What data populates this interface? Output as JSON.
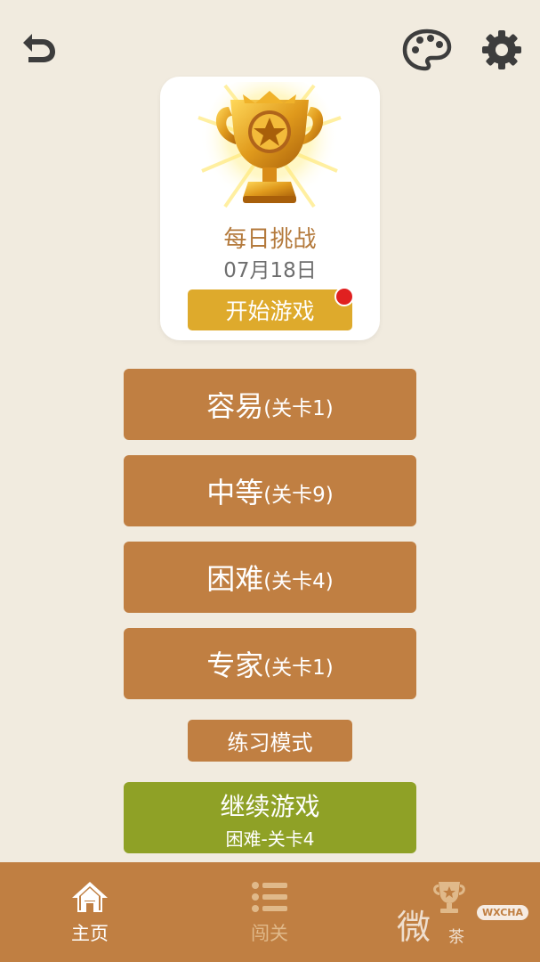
{
  "header": {
    "back_icon": "back-arrow-icon",
    "palette_icon": "palette-icon",
    "settings_icon": "gear-icon"
  },
  "daily_challenge": {
    "icon": "trophy-icon",
    "title": "每日挑战",
    "date": "07月18日",
    "start_label": "开始游戏",
    "notification_dot": true
  },
  "levels": [
    {
      "name": "容易",
      "stage": "(关卡1)"
    },
    {
      "name": "中等",
      "stage": "(关卡9)"
    },
    {
      "name": "困难",
      "stage": "(关卡4)"
    },
    {
      "name": "专家",
      "stage": "(关卡1)"
    }
  ],
  "practice": {
    "label": "练习模式"
  },
  "continue_game": {
    "title": "继续游戏",
    "subtitle": "困难-关卡4"
  },
  "bottom_nav": [
    {
      "label": "主页",
      "icon": "home-icon",
      "active": true
    },
    {
      "label": "闯关",
      "icon": "list-icon",
      "active": false
    },
    {
      "label": "",
      "icon": "trophy-icon",
      "active": false
    }
  ],
  "watermark": {
    "char": "微",
    "badge": "WXCHA",
    "sub": "茶"
  },
  "colors": {
    "background": "#f1ebdf",
    "primary_brown": "#c07f42",
    "gold": "#deaa2c",
    "green": "#8fa126",
    "title_brown": "#b47a3c",
    "notification_red": "#e02020"
  }
}
